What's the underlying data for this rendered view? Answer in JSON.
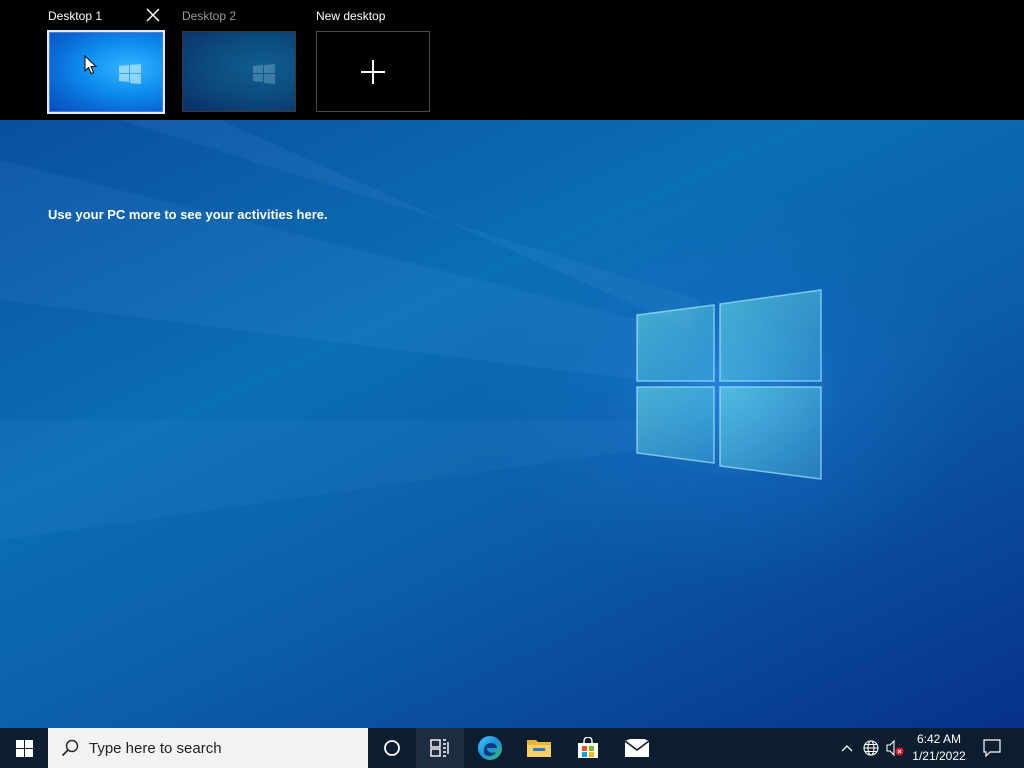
{
  "desktops": [
    {
      "label": "Desktop 1",
      "active": true
    },
    {
      "label": "Desktop 2",
      "active": false
    }
  ],
  "new_desktop_label": "New desktop",
  "timeline_message": "Use your PC more to see your activities here.",
  "taskbar": {
    "search_placeholder": "Type here to search",
    "apps": [
      "start-icon",
      "cortana-icon",
      "task-view-icon",
      "edge-icon",
      "file-explorer-icon",
      "store-icon",
      "mail-icon"
    ],
    "tray": {
      "icons": [
        "chevron-up-icon",
        "network-icon",
        "volume-muted-icon",
        "notifications-icon"
      ],
      "time": "6:42 AM",
      "date": "1/21/2022"
    }
  },
  "colors": {
    "taskbar": "#0b1d2e",
    "search_box": "#f3f3f3",
    "accent": "#0a63cf"
  }
}
